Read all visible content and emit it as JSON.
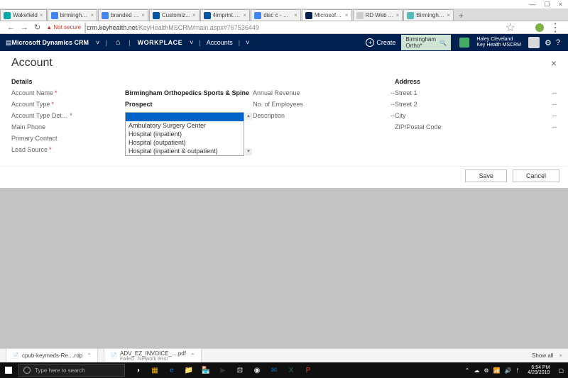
{
  "window": {
    "min": "—",
    "max": "☐",
    "close": "×"
  },
  "tabs": [
    {
      "fav": "#0aa",
      "label": "Wakefield"
    },
    {
      "fav": "#4285f4",
      "label": "birmingha..."
    },
    {
      "fav": "#4285f4",
      "label": "branded p..."
    },
    {
      "fav": "#0055a5",
      "label": "Customiz..."
    },
    {
      "fav": "#0055a5",
      "label": "4imprint.c..."
    },
    {
      "fav": "#4285f4",
      "label": "disc c - Go..."
    },
    {
      "fav": "#002050",
      "label": "Microsoft ..."
    },
    {
      "fav": "#ccc",
      "label": "RD Web A..."
    },
    {
      "fav": "#5bb",
      "label": "Birmingha..."
    }
  ],
  "addr": {
    "back": "←",
    "fwd": "→",
    "reload": "↻",
    "warn": "▲ Not secure",
    "url_host": "crm.keyhealth.net",
    "url_path": "/KeyHealthMSCRM/main.aspx#767536449"
  },
  "ext_icons": [
    {
      "c": "#ff6a00"
    },
    {
      "c": "#e60023"
    },
    {
      "c": "#333"
    },
    {
      "c": "#9b59b6"
    }
  ],
  "crm": {
    "brand": "Microsoft Dynamics CRM",
    "home": "⌂",
    "workplace": "WORKPLACE",
    "accounts": "Accounts",
    "create": "Create",
    "search_value": "Birmingham Ortho*",
    "user_name": "Haley Cleveland",
    "user_org": "Key Health MSCRM",
    "gear": "⚙",
    "help": "?"
  },
  "page": {
    "title": "Account",
    "close": "×"
  },
  "details": {
    "heading": "Details",
    "labels": {
      "name": "Account Name",
      "type": "Account Type",
      "typedet": "Account Type Det...",
      "phone": "Main Phone",
      "contact": "Primary Contact",
      "lead": "Lead Source"
    },
    "name_val": "Birmingham Orthopedics Sports & Spine",
    "type_val": "Prospect",
    "dropdown": [
      "Ambulatory Surgery Center",
      "Hospital (inpatient)",
      "Hospital (outpatient)",
      "Hospital (inpatient & outpatient)"
    ]
  },
  "metrics": {
    "rows": [
      {
        "l": "Annual Revenue",
        "v": "--"
      },
      {
        "l": "No. of Employees",
        "v": "--"
      },
      {
        "l": "Description",
        "v": "--"
      }
    ]
  },
  "address": {
    "heading": "Address",
    "rows": [
      {
        "l": "Street 1",
        "v": "--"
      },
      {
        "l": "Street 2",
        "v": "--"
      },
      {
        "l": "City",
        "v": "--"
      },
      {
        "l": "ZIP/Postal Code",
        "v": "--"
      }
    ]
  },
  "buttons": {
    "save": "Save",
    "cancel": "Cancel"
  },
  "downloads": {
    "items": [
      {
        "name": "cpub-keymeds-Re....rdp"
      },
      {
        "name": "ADV_EZ_INVOICE_....pdf",
        "sub": "Failed · Network error"
      }
    ],
    "showall": "Show all"
  },
  "taskbar": {
    "search_ph": "Type here to search",
    "tray": [
      "⌃",
      "☁",
      "⚙",
      "📶",
      "🔊",
      "ᚠ"
    ],
    "time": "6:54 PM",
    "date": "4/29/2019"
  },
  "apps": [
    {
      "c": "#fff",
      "t": "◑"
    },
    {
      "c": "#ffb900",
      "t": "▦"
    },
    {
      "c": "#0078d7",
      "t": "e"
    },
    {
      "c": "#ffb900",
      "t": "📁"
    },
    {
      "c": "#0078d7",
      "t": "🏪"
    },
    {
      "c": "#333",
      "t": "▶"
    },
    {
      "c": "#fff",
      "t": "⊡"
    },
    {
      "c": "#fff",
      "t": "◉"
    },
    {
      "c": "#0072c6",
      "t": "✉"
    },
    {
      "c": "#217346",
      "t": "X"
    },
    {
      "c": "#d24726",
      "t": "P"
    }
  ]
}
